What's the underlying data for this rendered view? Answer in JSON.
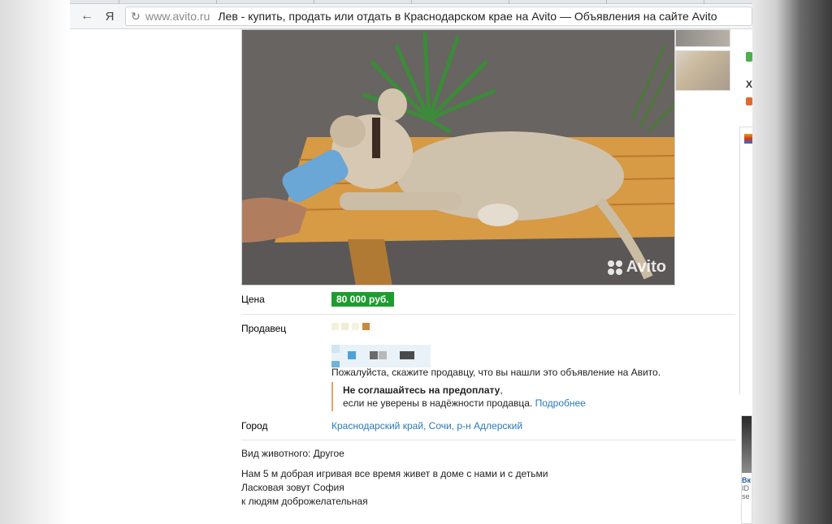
{
  "browser": {
    "domain": "www.avito.ru",
    "page_title": "Лев - купить, продать или отдать в Краснодарском крае на Avito — Объявления на сайте Avito",
    "back_icon": "arrow-left-icon",
    "yandex_glyph": "Я",
    "reload_icon": "reload-icon"
  },
  "photo": {
    "watermark": "Avito"
  },
  "listing": {
    "price_label": "Цена",
    "price_value": "80 000 руб.",
    "seller_label": "Продавец",
    "notice_text": "Пожалуйста, скажите продавцу, что вы нашли это объявление на Авито.",
    "warning_title": "Не соглашайтесь на предоплату",
    "warning_text_suffix": ",",
    "warning_text": "если не уверены в надёжности продавца.",
    "warning_link": "Подробнее",
    "city_label": "Город",
    "city_value": "Краснодарский край, Сочи, р-н Адлерский",
    "animal_type": "Вид животного: Другое",
    "description_lines": [
      "Нам 5 м добрая игривая все время живет в доме с нами и с детьми",
      "Ласковая зовут София",
      "к людям доброжелательная"
    ]
  },
  "right_column": {
    "x_letter": "Х",
    "card_title": "Вк",
    "card_sub1": "ID",
    "card_sub2": "se"
  },
  "colors": {
    "price_badge": "#1f9c2f",
    "link": "#2a7ab8",
    "warning_border": "#e6a26c"
  }
}
